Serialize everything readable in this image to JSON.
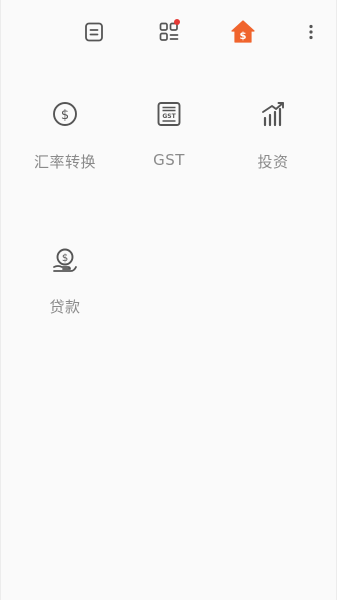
{
  "topbar": {
    "icons": [
      "list-icon",
      "apps-icon",
      "home-dollar-icon",
      "more-vertical-icon"
    ],
    "accent_color": "#f0642d",
    "notification_color": "#e53935"
  },
  "tools": [
    {
      "label": "汇率转换",
      "icon": "currency-exchange-icon"
    },
    {
      "label": "GST",
      "icon": "gst-calculator-icon"
    },
    {
      "label": "投资",
      "icon": "investment-chart-icon"
    },
    {
      "label": "贷款",
      "icon": "loan-hand-coin-icon"
    }
  ]
}
